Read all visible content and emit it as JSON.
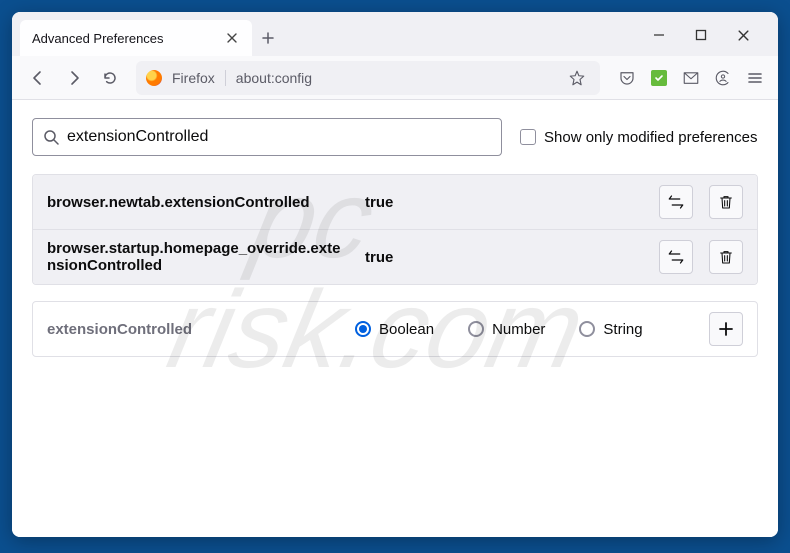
{
  "window": {
    "tab_title": "Advanced Preferences"
  },
  "navbar": {
    "identity": "Firefox",
    "url": "about:config"
  },
  "search": {
    "value": "extensionControlled",
    "checkbox_label": "Show only modified preferences",
    "checked": false
  },
  "prefs": [
    {
      "name": "browser.newtab.extensionControlled",
      "value": "true"
    },
    {
      "name": "browser.startup.homepage_override.extensionControlled",
      "value": "true"
    }
  ],
  "new_pref": {
    "name": "extensionControlled",
    "types": [
      "Boolean",
      "Number",
      "String"
    ],
    "selected": "Boolean"
  },
  "watermark": {
    "line1": "pc",
    "line2": "risk.com"
  }
}
